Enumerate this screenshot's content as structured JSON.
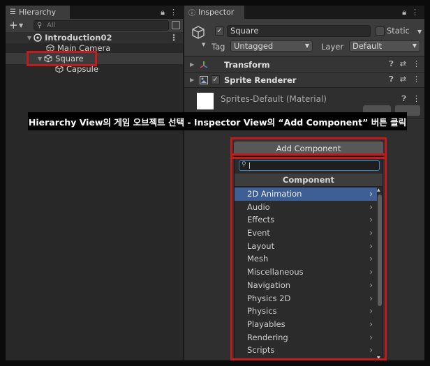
{
  "hierarchy": {
    "tab_label": "Hierarchy",
    "search_placeholder": "All",
    "scene": "Introduction02",
    "items": [
      {
        "label": "Main Camera"
      },
      {
        "label": "Square"
      },
      {
        "label": "Capsule"
      }
    ]
  },
  "inspector": {
    "tab_label": "Inspector",
    "object_name": "Square",
    "static_label": "Static",
    "tag_label": "Tag",
    "tag_value": "Untagged",
    "layer_label": "Layer",
    "layer_value": "Default",
    "components": [
      {
        "name": "Transform"
      },
      {
        "name": "Sprite Renderer"
      }
    ],
    "material_name": "Sprites-Default (Material)"
  },
  "banner": {
    "text": "Hierarchy View의 게임 오브젝트 선택 - Inspector View의 “Add Component” 버튼 클릭"
  },
  "add_component": {
    "button_label": "Add Component",
    "header": "Component",
    "items": [
      {
        "label": "2D Animation"
      },
      {
        "label": "Audio"
      },
      {
        "label": "Effects"
      },
      {
        "label": "Event"
      },
      {
        "label": "Layout"
      },
      {
        "label": "Mesh"
      },
      {
        "label": "Miscellaneous"
      },
      {
        "label": "Navigation"
      },
      {
        "label": "Physics 2D"
      },
      {
        "label": "Physics"
      },
      {
        "label": "Playables"
      },
      {
        "label": "Rendering"
      },
      {
        "label": "Scripts"
      }
    ]
  },
  "colors": {
    "highlight_red": "#c11b1b",
    "selection_blue": "#3e5f96"
  }
}
